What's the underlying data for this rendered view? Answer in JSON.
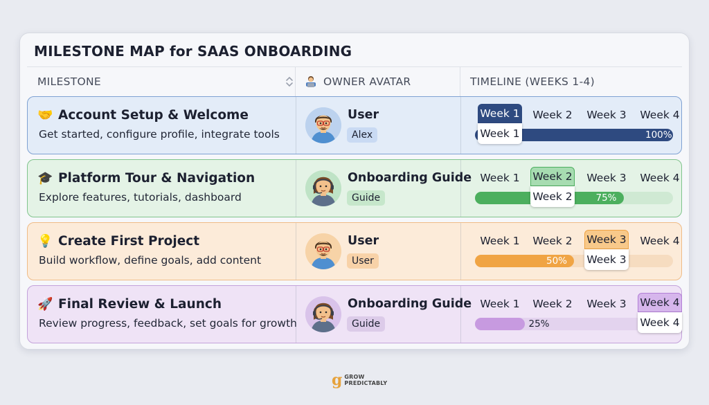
{
  "title": "MILESTONE MAP for SAAS ONBOARDING",
  "columns": {
    "milestone": "MILESTONE",
    "owner": "OWNER AVATAR",
    "timeline": "TIMELINE (WEEKS 1-4)"
  },
  "weeks": [
    "Week 1",
    "Week 2",
    "Week 3",
    "Week 4"
  ],
  "rows": [
    {
      "emoji": "🤝",
      "title": "Account Setup & Welcome",
      "desc": "Get started, configure profile, integrate tools",
      "owner": "User",
      "badge": "Alex",
      "active_week": "Week 1",
      "progress_label": "100%",
      "progress": 100,
      "colors": {
        "bg": "#e3ecf8",
        "border": "#7ea1d2",
        "fill": "#2e4a80",
        "track": "#d6e0ef",
        "badge": "#c9daf3",
        "pct": "#ffffff"
      }
    },
    {
      "emoji": "🎓",
      "title": "Platform Tour & Navigation",
      "desc": "Explore features, tutorials, dashboard",
      "owner": "Onboarding Guide",
      "badge": "Guide",
      "active_week": "Week 2",
      "progress_label": "75%",
      "progress": 75,
      "colors": {
        "bg": "#e4f3e6",
        "border": "#80c48c",
        "fill": "#4caf5e",
        "track": "#cfe9d3",
        "badge": "#c6e7cb",
        "pct": "#ffffff"
      }
    },
    {
      "emoji": "💡",
      "title": "Create First Project",
      "desc": "Build workflow, define goals, add content",
      "owner": "User",
      "badge": "User",
      "active_week": "Week 3",
      "progress_label": "50%",
      "progress": 50,
      "colors": {
        "bg": "#fcebd9",
        "border": "#efbb86",
        "fill": "#f0a444",
        "track": "#f6dcc0",
        "badge": "#f8d2a8",
        "pct": "#ffffff"
      }
    },
    {
      "emoji": "🚀",
      "title": "Final Review & Launch",
      "desc": "Review progress, feedback, set goals for growth",
      "owner": "Onboarding Guide",
      "badge": "Guide",
      "active_week": "Week 4",
      "progress_label": "25%",
      "progress": 25,
      "colors": {
        "bg": "#efe3f6",
        "border": "#c3a2da",
        "fill": "#c79ae0",
        "track": "#e3d3ee",
        "badge": "#dccbe9",
        "pct": "#1c2030"
      }
    }
  ],
  "footer": {
    "logo_letter": "g",
    "logo_line1": "GROW",
    "logo_line2": "PREDICTABLY"
  }
}
